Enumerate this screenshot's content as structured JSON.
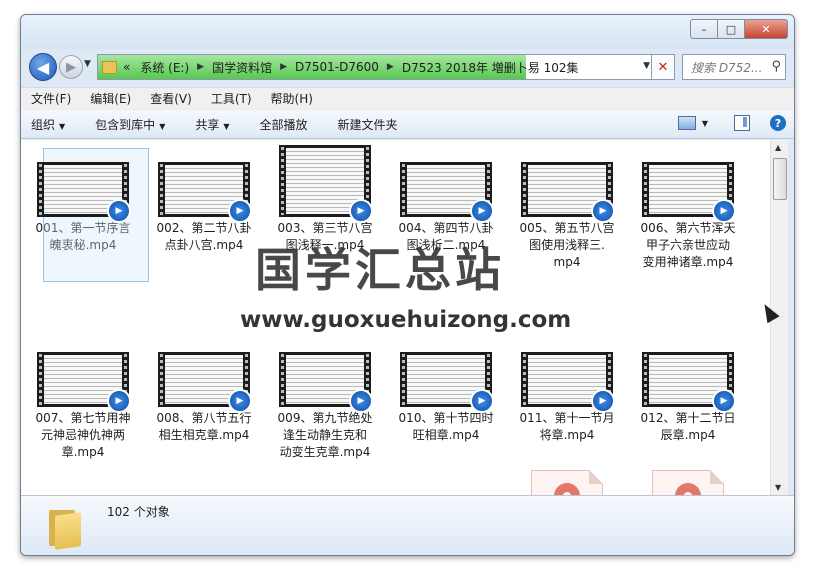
{
  "window": {
    "controls": {
      "minimize": "–",
      "maximize": "□",
      "close": "✕"
    }
  },
  "nav": {
    "back_icon": "◀",
    "forward_icon": "▶",
    "history_icon": "▼",
    "address_crumbs": [
      "«",
      "系统 (E:)",
      "国学资料馆",
      "D7501-D7600",
      "D7523 2018年 増删卜易 102集"
    ],
    "crumb_sep": "▶",
    "address_drop": "▼",
    "refresh_icon": "✕",
    "search_placeholder": "搜索 D752...",
    "search_icon": "⚲"
  },
  "menubar": [
    "文件(F)",
    "编辑(E)",
    "查看(V)",
    "工具(T)",
    "帮助(H)"
  ],
  "toolbar": {
    "items": [
      {
        "label": "组织",
        "caret": "▼"
      },
      {
        "label": "包含到库中",
        "caret": "▼"
      },
      {
        "label": "共享",
        "caret": "▼"
      },
      {
        "label": "全部播放",
        "caret": ""
      },
      {
        "label": "新建文件夹",
        "caret": ""
      }
    ],
    "view_caret": "▼",
    "help_label": "?"
  },
  "files": [
    {
      "name": "001、第一节序言魄衷秘.mp4",
      "line1": "001、第一节序言",
      "line2": "魄衷秘.mp4",
      "line3": "",
      "type": "video",
      "selected": true
    },
    {
      "name": "002、第二节八卦点卦八宫.mp4",
      "line1": "002、第二节八卦",
      "line2": "点卦八宫.mp4",
      "line3": "",
      "type": "video"
    },
    {
      "name": "003、第三节八宫图浅释一.mp4",
      "line1": "003、第三节八宫",
      "line2": "图浅释一.mp4",
      "line3": "",
      "type": "video"
    },
    {
      "name": "004、第四节八卦图浅析二.mp4",
      "line1": "004、第四节八卦",
      "line2": "图浅析二.mp4",
      "line3": "",
      "type": "video"
    },
    {
      "name": "005、第五节八宫图使用浅释三.mp4",
      "line1": "005、第五节八宫",
      "line2": "图使用浅释三.",
      "line3": "mp4",
      "type": "video"
    },
    {
      "name": "006、第六节浑天甲子六亲世应动变用神诸章.mp4",
      "line1": "006、第六节浑天",
      "line2": "甲子六亲世应动",
      "line3": "变用神诸章.mp4",
      "type": "video"
    },
    {
      "name": "007、第七节用神元神忌神仇神两章.mp4",
      "line1": "007、第七节用神",
      "line2": "元神忌神仇神两",
      "line3": "章.mp4",
      "type": "video"
    },
    {
      "name": "008、第八节五行相生相克章.mp4",
      "line1": "008、第八节五行",
      "line2": "相生相克章.mp4",
      "line3": "",
      "type": "video"
    },
    {
      "name": "009、第九节绝处逢生动静生克和动变生克章.mp4",
      "line1": "009、第九节绝处",
      "line2": "逢生动静生克和",
      "line3": "动变生克章.mp4",
      "type": "video"
    },
    {
      "name": "010、第十节四时旺相章.mp4",
      "line1": "010、第十节四时",
      "line2": "旺相章.mp4",
      "line3": "",
      "type": "video"
    },
    {
      "name": "011、第十一节月将章.mp4",
      "line1": "011、第十一节月",
      "line2": "将章.mp4",
      "line3": "",
      "type": "video"
    },
    {
      "name": "012、第十二节日辰章.mp4",
      "line1": "012、第十二节日",
      "line2": "辰章.mp4",
      "line3": "",
      "type": "video"
    }
  ],
  "status": {
    "count_text": "102 个对象"
  },
  "watermark": {
    "main": "国学汇总站",
    "url": "www.guoxuehuizong.com"
  },
  "colors": {
    "address_progress": "#57c84e",
    "selection": "#cde4fc",
    "play_badge": "#1f6fd0"
  }
}
